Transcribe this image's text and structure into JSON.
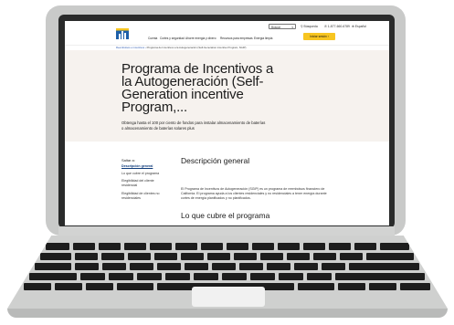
{
  "header": {
    "search_label": "Buscar",
    "util_links": [
      "Búsqueda",
      "1-877-660-6789",
      "Español"
    ],
    "nav_items": [
      "Cuenta",
      "Cortes y seguridad",
      "Ahorre energía y dinero",
      "Recursos para empresas",
      "Energía limpia"
    ],
    "cta_label": "Iniciar sesión"
  },
  "breadcrumb": {
    "items": [
      "Reembolsos e incentivos",
      "Programa de Incentivos a la Autogeneración (Self-Generation incentive Program, SGIP)"
    ]
  },
  "hero": {
    "title": "Programa de Incentivos a la Autogeneración (Self-Generation incentive Program,...",
    "subtitle": "Obtenga hasta el 100 por ciento de fondos para instalar almacenamiento de baterías o almacenamiento de baterías solares plus"
  },
  "sidebar": {
    "title": "Saltar a:",
    "items": [
      "Descripción general",
      "Lo que cubre el programa",
      "Elegibilidad del cliente residencial",
      "Elegibilidad de clientes no residenciales"
    ]
  },
  "main": {
    "section1_title": "Descripción general",
    "section1_text": "El Programa de Incentivos de Autogeneración (SGIP) es un programa de reembolsos financiero de California. El programa ayuda a los clientes residenciales y no residenciales a tener energía durante cortes de energía planificados y no planificados.",
    "section2_title": "Lo que cubre el programa"
  },
  "colors": {
    "cta": "#f7c521",
    "hero_bg": "#f6f2ee",
    "laptop_body": "#c9cac9",
    "bezel": "#2a2b2b"
  }
}
